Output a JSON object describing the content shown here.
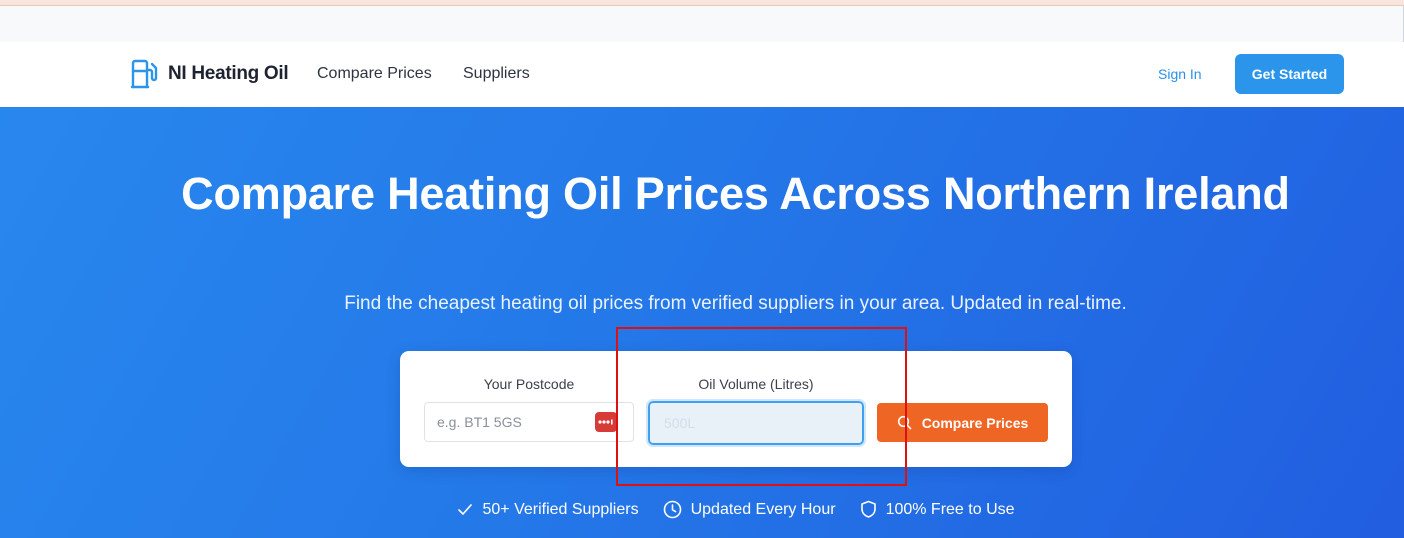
{
  "header": {
    "brand_name": "NI Heating Oil",
    "brand_icon": "fuel-pump-icon",
    "nav": [
      {
        "label": "Compare Prices"
      },
      {
        "label": "Suppliers"
      }
    ],
    "sign_in": "Sign In",
    "get_started": "Get Started"
  },
  "hero": {
    "title": "Compare Heating Oil Prices Across Northern Ireland",
    "subtitle": "Find the cheapest heating oil prices from verified suppliers in your area. Updated in real-time."
  },
  "search": {
    "postcode_label": "Your Postcode",
    "postcode_placeholder": "e.g. BT1 5GS",
    "postcode_value": "",
    "volume_label": "Oil Volume (Litres)",
    "volume_placeholder": "500L",
    "volume_value": "",
    "submit_label": "Compare Prices"
  },
  "features": [
    {
      "icon": "check-icon",
      "label": "50+ Verified Suppliers"
    },
    {
      "icon": "clock-icon",
      "label": "Updated Every Hour"
    },
    {
      "icon": "shield-icon",
      "label": "100% Free to Use"
    }
  ],
  "colors": {
    "primary": "#2b95ec",
    "hero_start": "#2887ee",
    "hero_end": "#215ee0",
    "accent": "#ef6524",
    "annotation": "#e01010"
  }
}
